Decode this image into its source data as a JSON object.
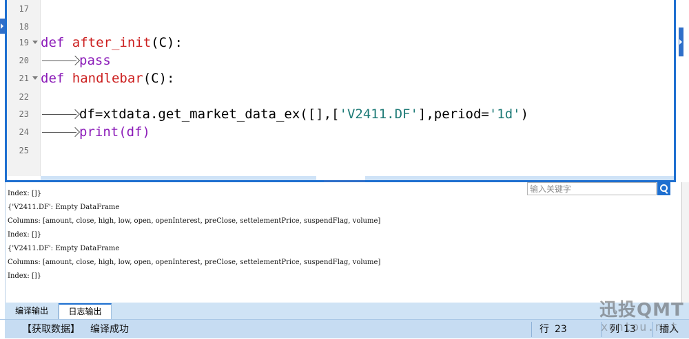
{
  "editor": {
    "lines": [
      {
        "num": "17"
      },
      {
        "num": "18"
      },
      {
        "num": "19",
        "kw": "def",
        "fn": "after_init",
        "rest": "(C):"
      },
      {
        "num": "20",
        "body": "pass"
      },
      {
        "num": "21",
        "kw": "def",
        "fn": "handlebar",
        "rest": "(C):"
      },
      {
        "num": "22"
      },
      {
        "num": "23",
        "pre": "df=xtdata.get_market_data_ex([],[",
        "str": "'V2411.DF'",
        "mid": "],period=",
        "str2": "'1d'",
        "post": ")"
      },
      {
        "num": "24",
        "body": "print(df)"
      },
      {
        "num": "25"
      }
    ]
  },
  "output": {
    "search_placeholder": "输入关键字",
    "lines": [
      "Index: []}",
      "{'V2411.DF': Empty DataFrame",
      "Columns: [amount, close, high, low, open, openInterest, preClose, settelementPrice, suspendFlag, volume]",
      "Index: []}",
      "{'V2411.DF': Empty DataFrame",
      "Columns: [amount, close, high, low, open, openInterest, preClose, settelementPrice, suspendFlag, volume]",
      "Index: []}"
    ]
  },
  "tabs": {
    "compile_output": "编译输出",
    "log_output": "日志输出"
  },
  "status": {
    "process": "【获取数据】",
    "message": "编译成功",
    "row_label": "行",
    "row_value": "23",
    "col_label": "列",
    "col_value": "13",
    "mode": "插入"
  },
  "watermark": {
    "title": "迅投QMT",
    "url": "xuntou.net"
  },
  "colors": {
    "accent": "#1e6fd0",
    "keyword": "#8b1bb8",
    "function": "#cc1f1f",
    "string": "#1d7a76"
  }
}
